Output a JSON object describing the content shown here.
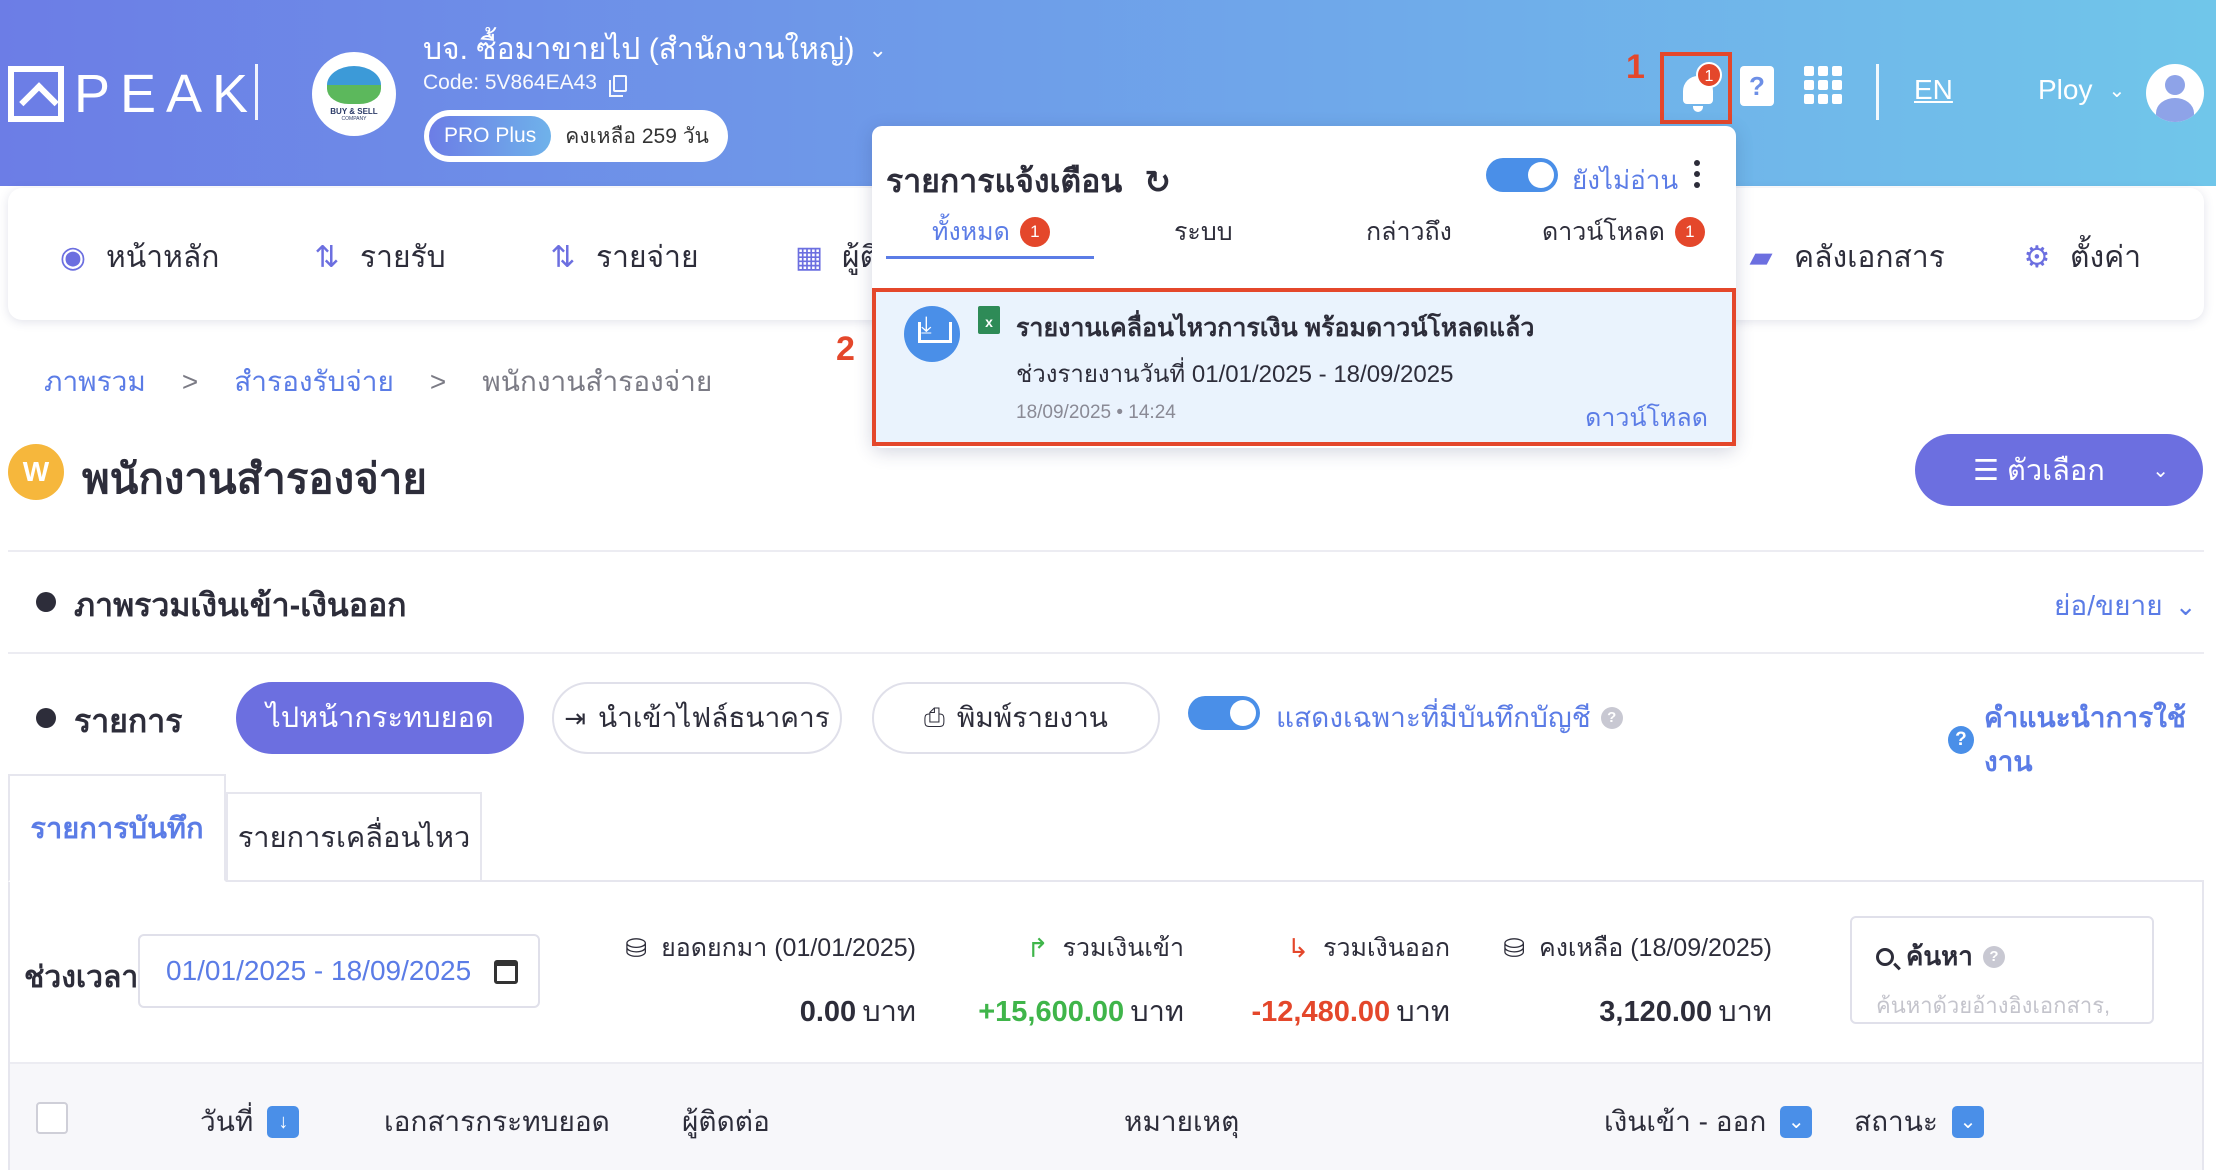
{
  "header": {
    "logo_text": "PEAK",
    "company_name": "บจ. ซื้อมาขายไป (สำนักงานใหญ่)",
    "company_logo_text": "BUY & SELL",
    "company_logo_sub": "COMPANY",
    "code": "Code: 5V864EA43",
    "plan": "PRO Plus",
    "days_left": "คงเหลือ 259 วัน",
    "marker_1": "1",
    "bell_count": "1",
    "help_icon": "?",
    "language": "EN",
    "user_name": "Ploy"
  },
  "nav": {
    "items": [
      {
        "label": "หน้าหลัก",
        "icon": "chart-icon",
        "glyph": "◉"
      },
      {
        "label": "รายรับ",
        "icon": "income-icon",
        "glyph": "⇅"
      },
      {
        "label": "รายจ่าย",
        "icon": "expense-icon",
        "glyph": "⇅"
      },
      {
        "label": "ผู้ติ",
        "icon": "contacts-icon",
        "glyph": "▦"
      },
      {
        "label": "คลังเอกสาร",
        "icon": "folder-icon",
        "glyph": "▰"
      },
      {
        "label": "ตั้งค่า",
        "icon": "gear-icon",
        "glyph": "⚙"
      }
    ]
  },
  "breadcrumb": {
    "items": [
      "ภาพรวม",
      "สำรองรับจ่าย"
    ],
    "current": "พนักงานสำรองจ่าย",
    "separator": ">"
  },
  "page": {
    "badge": "W",
    "title": "พนักงานสำรองจ่าย",
    "options_label": "☰ ตัวเลือก"
  },
  "overview": {
    "title": "ภาพรวมเงินเข้า-เงินออก",
    "collapse_label": "ย่อ/ขยาย"
  },
  "list": {
    "title": "รายการ",
    "goto_button": "ไปหน้ากระทบยอด",
    "import_button": "นำเข้าไฟล์ธนาคาร",
    "print_button": "พิมพ์รายงาน",
    "toggle_label": "แสดงเฉพาะที่มีบันทึกบัญชี",
    "guide_label": "คำแนะนำการใช้งาน"
  },
  "tabs": [
    {
      "label": "รายการบันทึก",
      "active": true
    },
    {
      "label": "รายการเคลื่อนไหว",
      "active": false
    }
  ],
  "filter": {
    "period_label": "ช่วงเวลา",
    "date_range": "01/01/2025 - 18/09/2025"
  },
  "stats": [
    {
      "label": "ยอดยกมา (01/01/2025)",
      "value": "0.00",
      "unit": "บาท",
      "color": "#2d2d3a",
      "icon": "coins-icon"
    },
    {
      "label": "รวมเงินเข้า",
      "value": "+15,600.00",
      "unit": "บาท",
      "color": "#3fb54a",
      "icon": "arrow-in-icon"
    },
    {
      "label": "รวมเงินออก",
      "value": "-12,480.00",
      "unit": "บาท",
      "color": "#e4472b",
      "icon": "arrow-out-icon"
    },
    {
      "label": "คงเหลือ (18/09/2025)",
      "value": "3,120.00",
      "unit": "บาท",
      "color": "#2d2d3a",
      "icon": "coins-icon"
    }
  ],
  "search": {
    "title": "ค้นหา",
    "placeholder": "ค้นหาด้วยอ้างอิงเอกสาร,"
  },
  "table": {
    "columns": [
      "วันที่",
      "เอกสารกระทบยอด",
      "ผู้ติดต่อ",
      "หมายเหตุ",
      "เงินเข้า - ออก",
      "สถานะ"
    ]
  },
  "notifications": {
    "title": "รายการแจ้งเตือน",
    "unread_label": "ยังไม่อ่าน",
    "tabs": [
      {
        "label": "ทั้งหมด",
        "count": "1"
      },
      {
        "label": "ระบบ",
        "count": ""
      },
      {
        "label": "กล่าวถึง",
        "count": ""
      },
      {
        "label": "ดาวน์โหลด",
        "count": "1"
      }
    ],
    "marker_2": "2",
    "item": {
      "title": "รายงานเคลื่อนไหวการเงิน พร้อมดาวน์โหลดแล้ว",
      "description": "ช่วงรายงานวันที่ 01/01/2025 - 18/09/2025",
      "time": "18/09/2025 • 14:24",
      "action": "ดาวน์โหลด"
    }
  },
  "colors": {
    "accent": "#6c6fe0",
    "link": "#5b7ce6",
    "highlight": "#e4472b"
  }
}
